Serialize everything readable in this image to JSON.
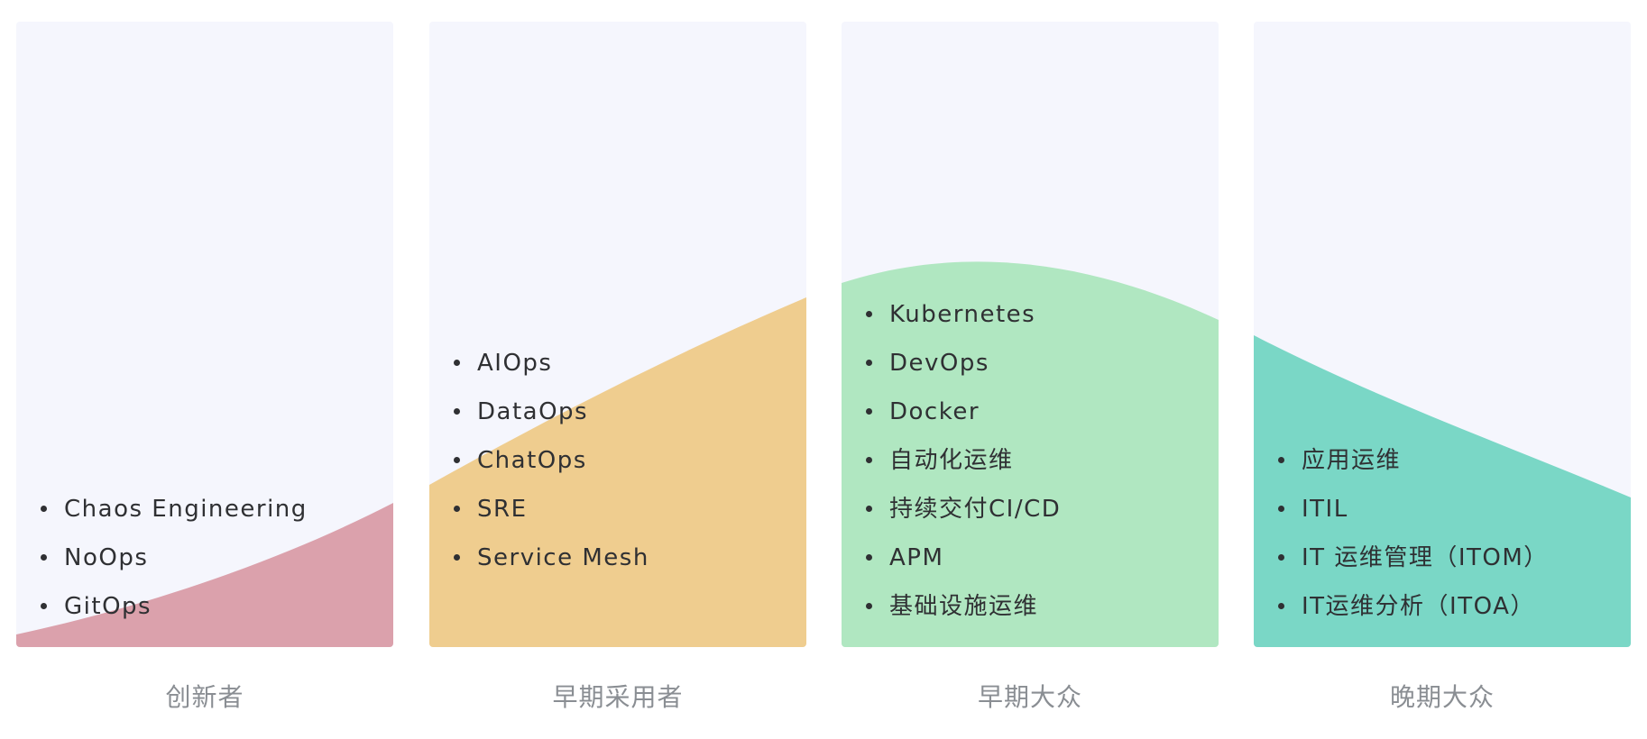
{
  "colors": {
    "panel_background": "#f5f6fd",
    "innovators_fill": "#dba1ac",
    "early_adopters_fill": "#efcd8f",
    "early_majority_fill": "#b0e7c1",
    "late_majority_fill": "#7ad7c6",
    "item_text": "#2f3033",
    "caption_text": "#8a8e93"
  },
  "columns": [
    {
      "id": "innovators",
      "caption": "创新者",
      "items": [
        "Chaos Engineering",
        "NoOps",
        "GitOps"
      ]
    },
    {
      "id": "early-adopters",
      "caption": "早期采用者",
      "items": [
        "AIOps",
        "DataOps",
        "ChatOps",
        "SRE",
        "Service Mesh"
      ]
    },
    {
      "id": "early-majority",
      "caption": "早期大众",
      "items": [
        "Kubernetes",
        "DevOps",
        "Docker",
        "自动化运维",
        "持续交付CI/CD",
        "APM",
        "基础设施运维"
      ]
    },
    {
      "id": "late-majority",
      "caption": "晚期大众",
      "items": [
        "应用运维",
        "ITIL",
        "IT 运维管理（ITOM）",
        "IT运维分析（ITOA）"
      ]
    }
  ]
}
